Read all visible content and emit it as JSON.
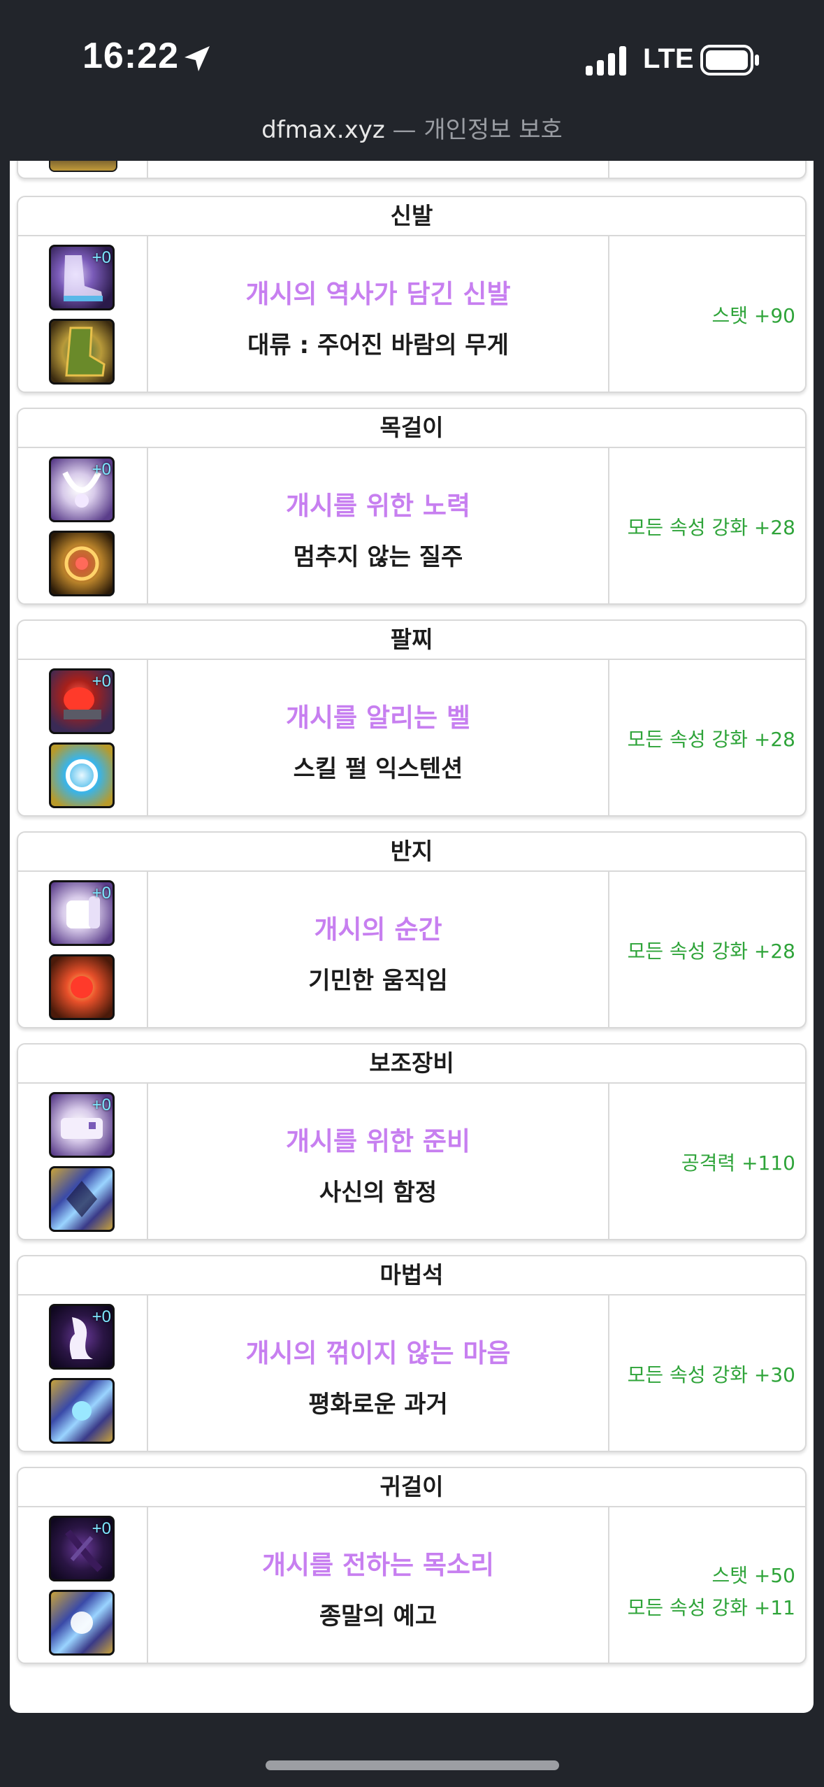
{
  "status_bar": {
    "time": "16:22",
    "network": "LTE",
    "icons": [
      "location-arrow-icon",
      "signal-bars-icon",
      "battery-icon"
    ]
  },
  "url_bar": {
    "domain": "dfmax.xyz",
    "separator": "—",
    "label": "개인정보 보호"
  },
  "colors": {
    "item_name": "#c77ff0",
    "stat": "#2fa43a",
    "chrome": "#22252b"
  },
  "equipment": [
    {
      "slot": "신발",
      "item_name": "개시의 역사가 담긴 신발",
      "sub_name": "대류 : 주어진 바람의 무게",
      "stats": [
        "스탯 +90"
      ],
      "icon_badge": "+0",
      "icons": [
        "boots-icon",
        "sub-boots-icon"
      ]
    },
    {
      "slot": "목걸이",
      "item_name": "개시를 위한 노력",
      "sub_name": "멈추지 않는 질주",
      "stats": [
        "모든 속성 강화 +28"
      ],
      "icon_badge": "+0",
      "icons": [
        "necklace-icon",
        "sub-necklace-icon"
      ]
    },
    {
      "slot": "팔찌",
      "item_name": "개시를 알리는 벨",
      "sub_name": "스킬 펄 익스텐션",
      "stats": [
        "모든 속성 강화 +28"
      ],
      "icon_badge": "+0",
      "icons": [
        "bell-bracelet-icon",
        "sub-bracelet-icon"
      ]
    },
    {
      "slot": "반지",
      "item_name": "개시의 순간",
      "sub_name": "기민한 움직임",
      "stats": [
        "모든 속성 강화 +28"
      ],
      "icon_badge": "+0",
      "icons": [
        "ring-icon",
        "sub-ring-icon"
      ]
    },
    {
      "slot": "보조장비",
      "item_name": "개시를 위한 준비",
      "sub_name": "사신의 함정",
      "stats": [
        "공격력 +110"
      ],
      "icon_badge": "+0",
      "icons": [
        "support-equipment-icon",
        "sub-support-icon"
      ]
    },
    {
      "slot": "마법석",
      "item_name": "개시의 꺾이지 않는 마음",
      "sub_name": "평화로운 과거",
      "stats": [
        "모든 속성 강화 +30"
      ],
      "icon_badge": "+0",
      "icons": [
        "magic-stone-icon",
        "sub-magic-stone-icon"
      ]
    },
    {
      "slot": "귀걸이",
      "item_name": "개시를 전하는 목소리",
      "sub_name": "종말의 예고",
      "stats": [
        "스탯 +50",
        "모든 속성 강화 +11"
      ],
      "icon_badge": "+0",
      "icons": [
        "earring-icon",
        "sub-earring-icon"
      ]
    }
  ]
}
